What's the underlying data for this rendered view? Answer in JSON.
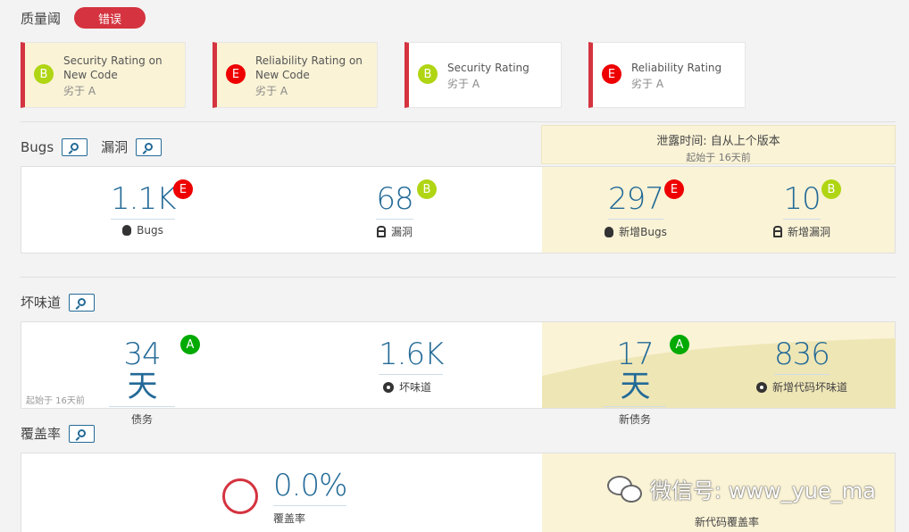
{
  "quality_gate": {
    "title": "质量阈",
    "status": "错误"
  },
  "conditions": [
    {
      "metric": "Security Rating on New Code",
      "rating": "B",
      "op": "劣于 A",
      "scope": "new"
    },
    {
      "metric": "Reliability Rating on New Code",
      "rating": "E",
      "op": "劣于 A",
      "scope": "new"
    },
    {
      "metric": "Security Rating",
      "rating": "B",
      "op": "劣于 A",
      "scope": "overall"
    },
    {
      "metric": "Reliability Rating",
      "rating": "E",
      "op": "劣于 A",
      "scope": "overall"
    }
  ],
  "sections": {
    "bugs_title": "Bugs",
    "vuln_title": "漏洞",
    "smells_title": "坏味道",
    "coverage_title": "覆盖率"
  },
  "leak": {
    "title": "泄露时间: 自从上个版本",
    "since": "起始于 16天前"
  },
  "bugs_panel": {
    "bugs": {
      "value": "1.1K",
      "rating": "E",
      "label": "Bugs"
    },
    "vulns": {
      "value": "68",
      "rating": "B",
      "label": "漏洞"
    },
    "new_bugs": {
      "value": "297",
      "rating": "E",
      "label": "新增Bugs"
    },
    "new_vulns": {
      "value": "10",
      "rating": "B",
      "label": "新增漏洞"
    }
  },
  "smells_panel": {
    "debt": {
      "value": "34天",
      "rating": "A",
      "label": "债务"
    },
    "smells": {
      "value": "1.6K",
      "label": "坏味道"
    },
    "new_debt": {
      "value": "17天",
      "rating": "A",
      "label": "新债务"
    },
    "new_smells": {
      "value": "836",
      "label": "新增代码坏味道"
    },
    "since_note": "起始于 16天前"
  },
  "coverage_panel": {
    "coverage": {
      "value": "0.0%",
      "label": "覆盖率"
    },
    "new_coverage": {
      "label": "新代码覆盖率"
    }
  },
  "watermark": "微信号: www_yue_ma"
}
